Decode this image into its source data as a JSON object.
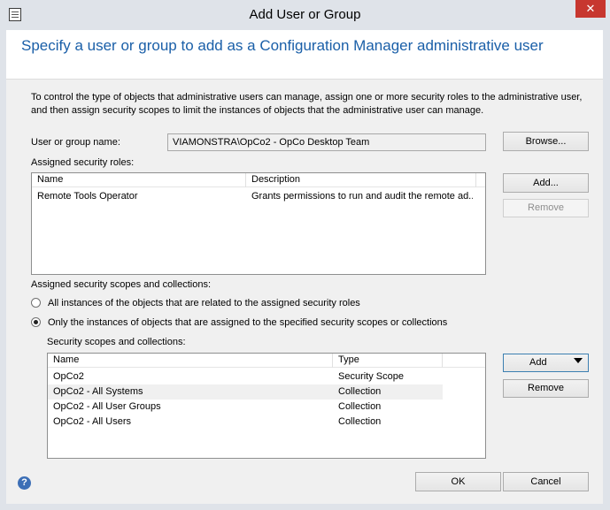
{
  "window": {
    "title": "Add User or Group",
    "close_glyph": "✕"
  },
  "header": {
    "heading": "Specify a user or group to add as a Configuration Manager administrative user"
  },
  "intro_text": "To control the type of objects that administrative users can manage, assign one or more security roles  to the  administrative user, and then assign security scopes to limit the instances of objects that the administrative user can manage.",
  "user": {
    "label": "User or group name:",
    "value": "VIAMONSTRA\\OpCo2 - OpCo Desktop Team",
    "browse_label": "Browse..."
  },
  "roles": {
    "label": "Assigned security roles:",
    "columns": [
      "Name",
      "Description"
    ],
    "rows": [
      {
        "name": "Remote Tools Operator",
        "description": "Grants permissions to run and audit the remote ad..."
      }
    ],
    "add_label": "Add...",
    "remove_label": "Remove"
  },
  "scopes": {
    "label": "Assigned security scopes and collections:",
    "option_all": "All instances of the objects that are related to the assigned security roles",
    "option_only": "Only the instances of objects that are assigned to the specified security scopes or collections",
    "selected_option": "only",
    "list_label": "Security scopes and collections:",
    "columns": [
      "Name",
      "Type"
    ],
    "rows": [
      {
        "name": "OpCo2",
        "type": "Security Scope"
      },
      {
        "name": "OpCo2 - All Systems",
        "type": "Collection"
      },
      {
        "name": "OpCo2 - All User Groups",
        "type": "Collection"
      },
      {
        "name": "OpCo2 - All Users",
        "type": "Collection"
      }
    ],
    "add_label": "Add",
    "remove_label": "Remove"
  },
  "footer": {
    "ok_label": "OK",
    "cancel_label": "Cancel",
    "help_glyph": "?"
  },
  "colors": {
    "heading": "#1a5fa8",
    "close_button": "#c7372f",
    "help_icon": "#3d6fb6"
  }
}
